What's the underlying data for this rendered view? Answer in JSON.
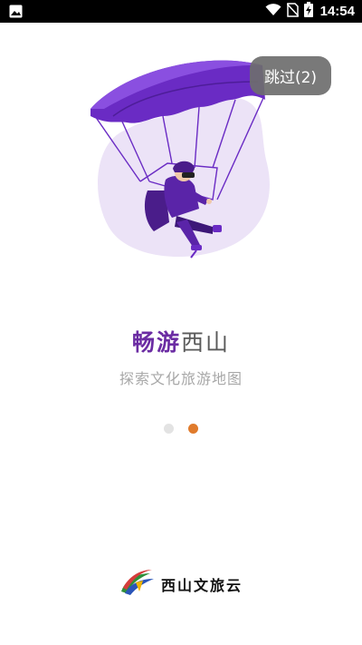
{
  "status_bar": {
    "time": "14:54",
    "icons": [
      "image-icon",
      "wifi-icon",
      "no-sim-icon",
      "battery-charging-icon"
    ]
  },
  "skip_button": {
    "label": "跳过(2)"
  },
  "headline": {
    "accent": "畅游",
    "rest": "西山"
  },
  "subtitle": "探索文化旅游地图",
  "pager": {
    "count": 2,
    "active_index": 1
  },
  "footer": {
    "logo_text": "西山文旅云"
  },
  "colors": {
    "accent_purple": "#6b2ca3",
    "dot_active": "#e07b2c",
    "dot_inactive": "#e3e3e3",
    "skip_bg": "#6e6e6e"
  }
}
